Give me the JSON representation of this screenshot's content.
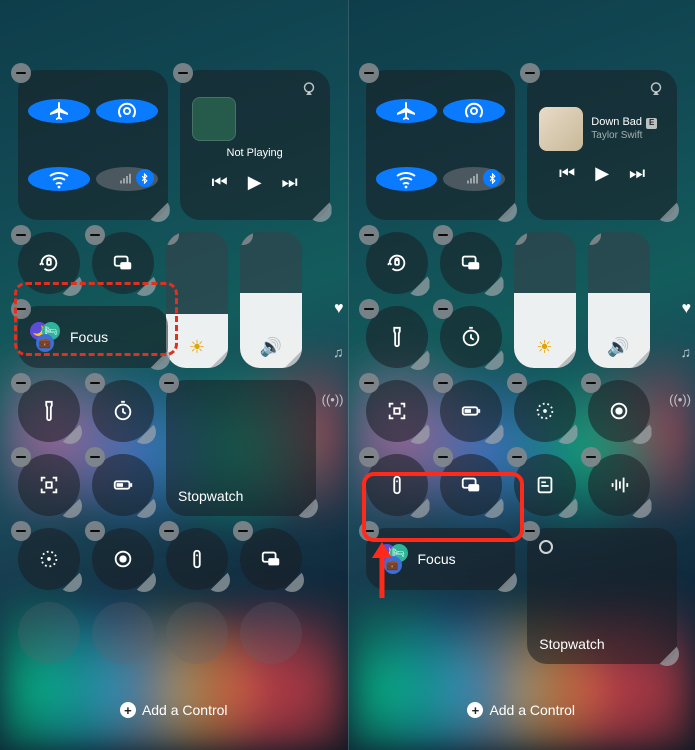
{
  "common": {
    "add_control": "Add a Control",
    "focus_label": "Focus",
    "stopwatch_label": "Stopwatch"
  },
  "left_screen": {
    "media": {
      "nowplaying": "Not Playing",
      "is_playing": false
    },
    "brightness_pct": 40,
    "volume_pct": 55,
    "controls_row3": [
      "flashlight-icon",
      "timer-icon"
    ],
    "controls_row4": [
      "qr-scan-icon",
      "battery-icon"
    ],
    "controls_row5": [
      "privacy-dots-icon",
      "record-icon",
      "remote-icon",
      "screen-mirror-icon"
    ],
    "annotation": {
      "type": "dashed",
      "target": "focus"
    }
  },
  "right_screen": {
    "media": {
      "title": "Down Bad",
      "explicit": true,
      "artist": "Taylor Swift",
      "is_playing": true
    },
    "brightness_pct": 55,
    "volume_pct": 55,
    "controls_row2": [
      "flashlight-icon",
      "timer-icon"
    ],
    "controls_row3": [
      "qr-scan-icon",
      "battery-icon",
      "privacy-dots-icon",
      "record-icon"
    ],
    "controls_row4": [
      "remote-icon",
      "screen-mirror-icon",
      "notes-icon",
      "audio-bars-icon"
    ],
    "annotation": {
      "type": "solid+arrow",
      "target": "focus"
    }
  }
}
